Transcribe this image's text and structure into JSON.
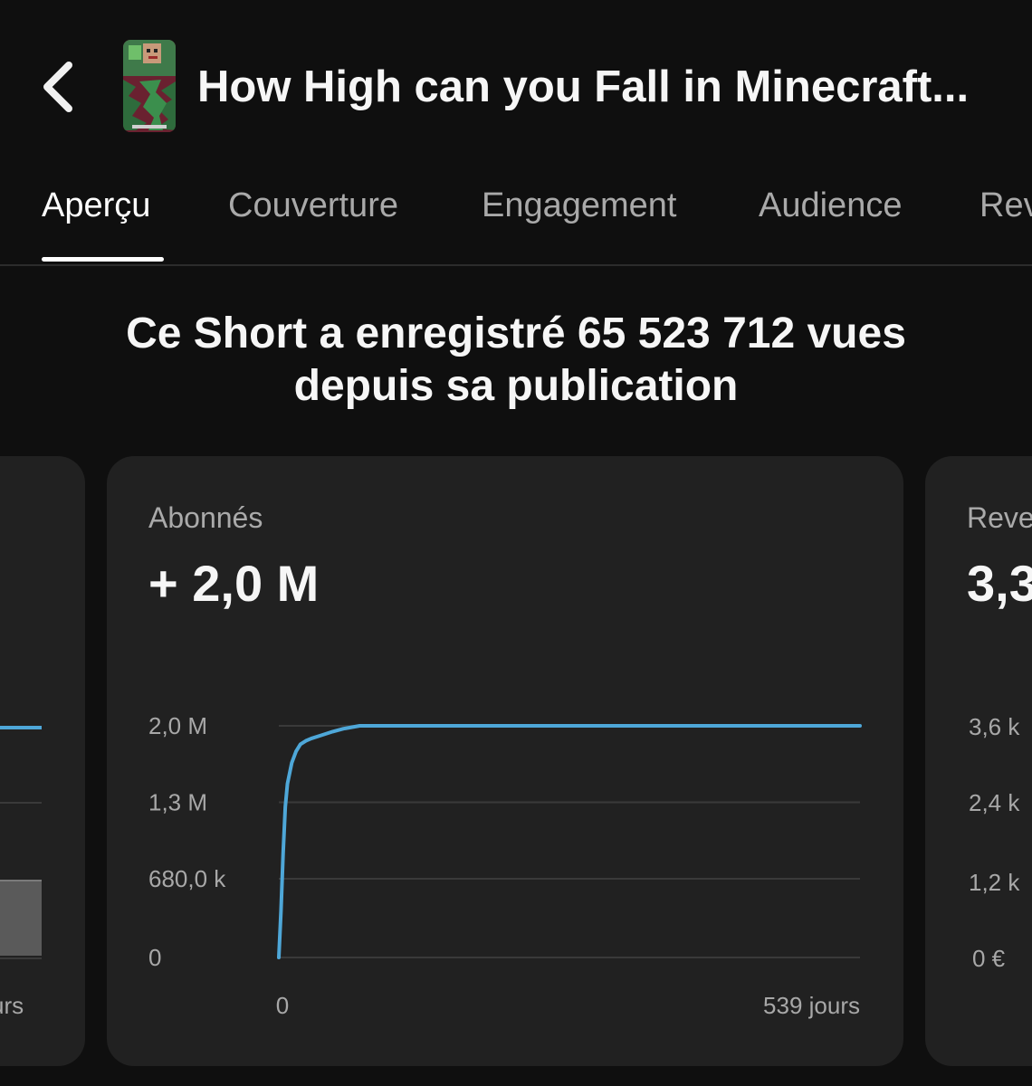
{
  "header": {
    "back_icon": "chevron-left-icon",
    "title": "How High can you Fall in Minecraft..."
  },
  "tabs": [
    {
      "label": "Aperçu",
      "active": true
    },
    {
      "label": "Couverture",
      "active": false
    },
    {
      "label": "Engagement",
      "active": false
    },
    {
      "label": "Audience",
      "active": false
    },
    {
      "label": "Rev",
      "active": false
    }
  ],
  "summary": {
    "line1": "Ce Short a enregistré 65 523 712 vues",
    "line2": "depuis sa publication"
  },
  "left_card": {
    "x_end_partial": "urs"
  },
  "main_card": {
    "label": "Abonnés",
    "value": "+ 2,0 M"
  },
  "right_card": {
    "label_partial": "Reve",
    "value_partial": "3,3",
    "y_ticks": [
      "3,6 k",
      "2,4 k",
      "1,2 k",
      "0 €"
    ]
  },
  "chart_data": {
    "type": "line",
    "title": "Abonnés",
    "x_tick_labels": [
      "0",
      "539 jours"
    ],
    "y_tick_labels": [
      "0",
      "680,0 k",
      "1,3 M",
      "2,0 M"
    ],
    "y_ticks": [
      0,
      680000,
      1340000,
      2000000
    ],
    "xlim": [
      0,
      539
    ],
    "ylim": [
      0,
      2000000
    ],
    "series": [
      {
        "color": "#4ea7d8",
        "x": [
          0,
          2,
          4,
          6,
          8,
          12,
          16,
          20,
          25,
          30,
          40,
          50,
          60,
          75,
          539
        ],
        "y": [
          0,
          400000,
          900000,
          1300000,
          1500000,
          1680000,
          1780000,
          1840000,
          1870000,
          1890000,
          1920000,
          1950000,
          1975000,
          2000000,
          2000000
        ]
      }
    ]
  },
  "colors": {
    "background": "#0f0f0f",
    "card": "#212121",
    "accent_line": "#4ea7d8",
    "gridline": "#3a3a3a"
  }
}
